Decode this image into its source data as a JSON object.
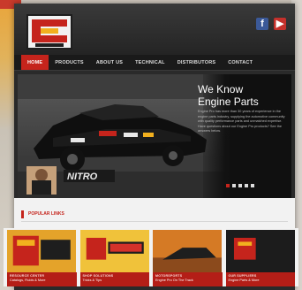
{
  "site": {
    "nav": [
      "HOME",
      "PRODUCTS",
      "ABOUT US",
      "TECHNICAL",
      "DISTRIBUTORS",
      "CONTACT"
    ],
    "social": [
      "f",
      "▶"
    ]
  },
  "hero": {
    "title_line1": "We Know",
    "title_line2": "Engine Parts",
    "body": "Engine Pro has more than 30 years of experience in the engine parts industry, supplying the automotive community with quality performance parts and unmatched expertise. Have questions about our Engine Pro products? See the answers below."
  },
  "popular": {
    "label": "POPULAR LINKS"
  },
  "tiles": [
    {
      "t1": "RESOURCE CENTER",
      "t2": "Catalogs, Fluids & More"
    },
    {
      "t1": "SHOP SOLUTIONS",
      "t2": "Tricks & Tips"
    },
    {
      "t1": "MOTORSPORTS",
      "t2": "Engine Pro On The Track"
    },
    {
      "t1": "OUR SUPPLIERS",
      "t2": "Engine Parts & More"
    }
  ]
}
